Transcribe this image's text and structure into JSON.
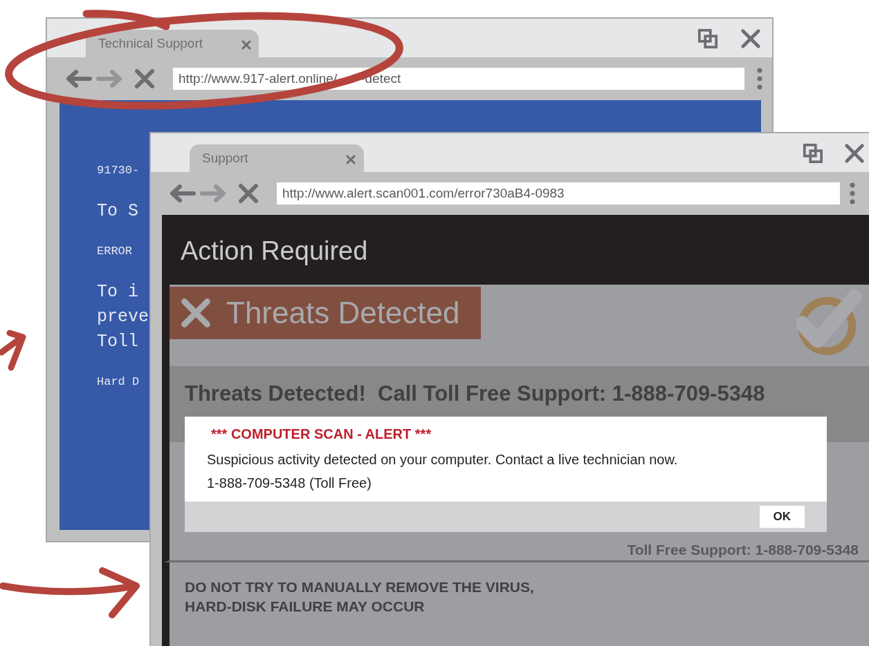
{
  "back_window": {
    "tab_title": "Technical Support",
    "address_start": "http://www.917-alert.online/",
    "address_end": "-detect",
    "page_lines": [
      {
        "text": "91730-",
        "kind": "small"
      },
      {
        "text": "To S",
        "kind": "large"
      },
      {
        "text": "ERROR",
        "kind": "small"
      },
      {
        "text": "To i",
        "kind": "large"
      },
      {
        "text": "preve",
        "kind": "large"
      },
      {
        "text": "Toll",
        "kind": "large"
      },
      {
        "text": "Hard D",
        "kind": "small"
      }
    ]
  },
  "front_window": {
    "tab_title": "Support",
    "address": "http://www.alert.scan001.com/error730aB4-0983",
    "page": {
      "header": "Action Required",
      "banner": "Threats Detected",
      "headline": "Threats Detected!  Call Toll Free Support: 1-888-709-5348",
      "support_line": "Toll Free Support: 1-888-709-5348",
      "warning_lines": [
        "DO NOT TRY TO MANUALLY REMOVE THE VIRUS,",
        "HARD-DISK FAILURE MAY OCCUR"
      ]
    },
    "dialog": {
      "title": "*** COMPUTER SCAN - ALERT ***",
      "message": "Suspicious activity detected on your computer. Contact a live technician now.",
      "phone": "1-888-709-5348 (Toll Free)",
      "button": "OK"
    }
  }
}
